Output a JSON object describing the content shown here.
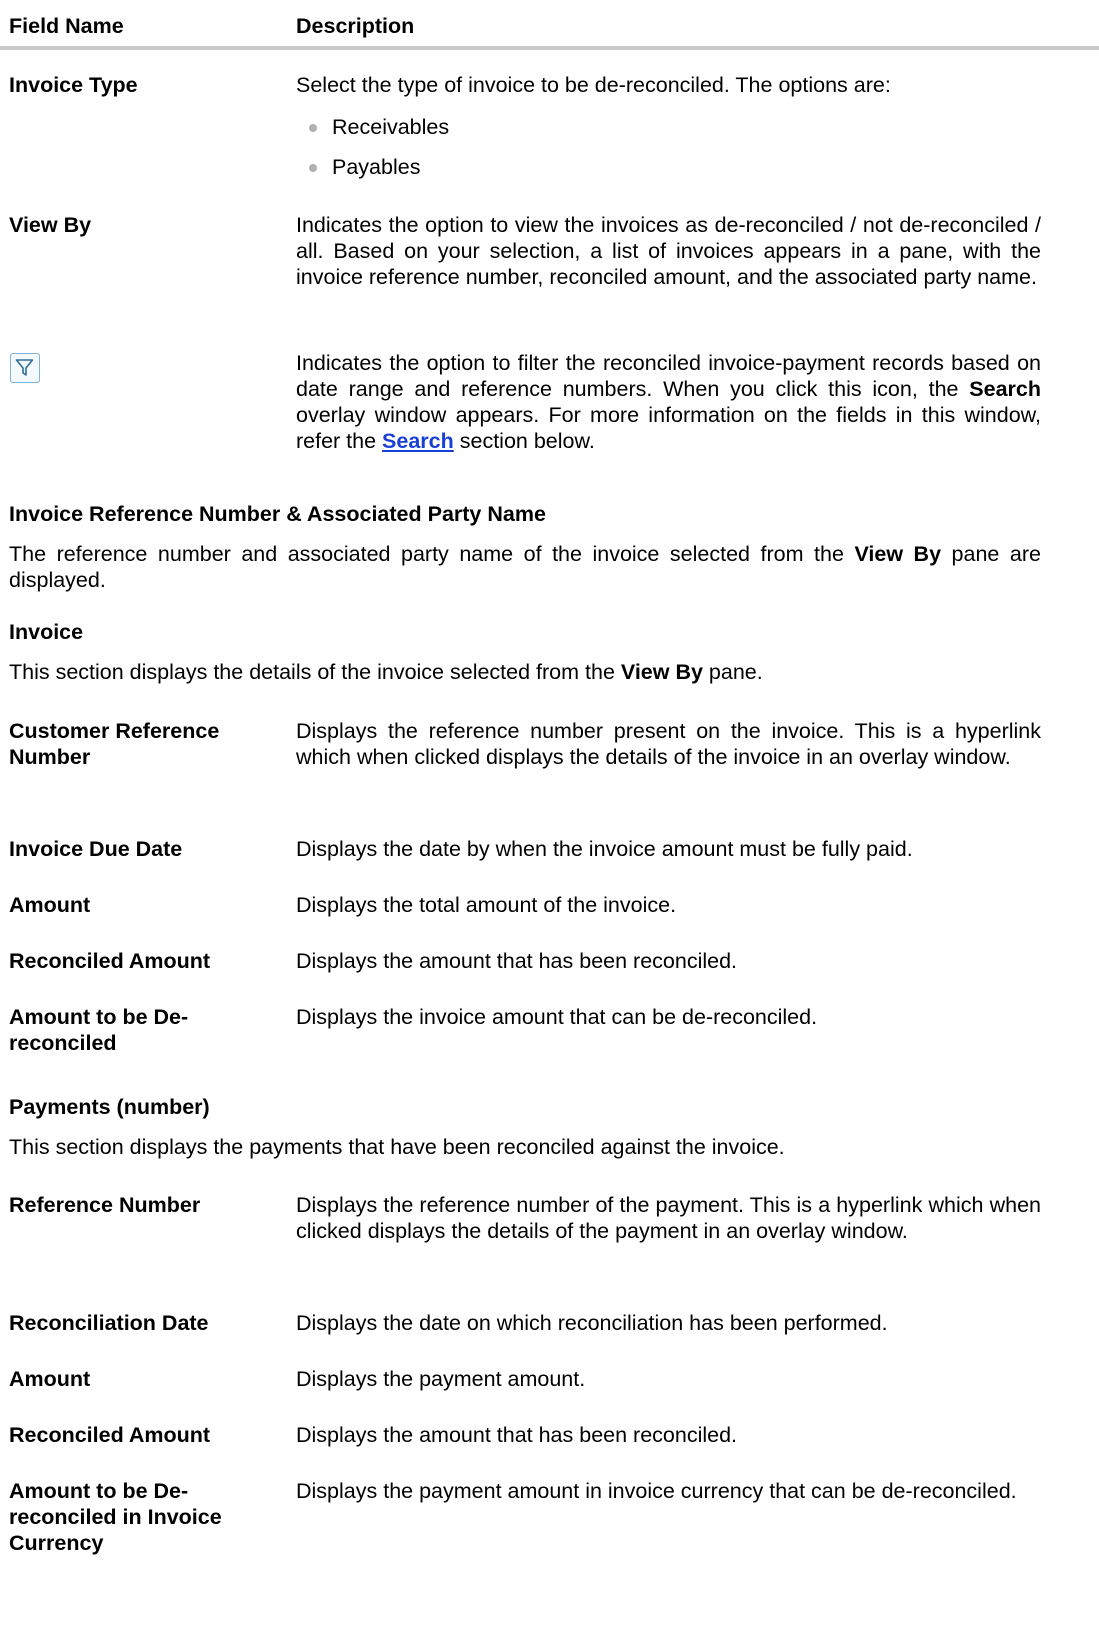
{
  "header": {
    "col1": "Field Name",
    "col2": "Description"
  },
  "invoice_type": {
    "label": "Invoice Type",
    "desc": "Select the type of invoice to be de-reconciled. The options are:",
    "options": [
      "Receivables",
      "Payables"
    ]
  },
  "view_by": {
    "label": "View By",
    "desc": "Indicates the option to view the invoices as de-reconciled / not de-reconciled / all. Based on your selection, a list of invoices appears in a pane, with the invoice reference number, reconciled amount, and the associated party name."
  },
  "filter": {
    "icon": "filter-icon",
    "desc_1": "Indicates the option to filter the reconciled invoice-payment records based on date range and reference numbers. When you click this icon, the ",
    "desc_bold": "Search",
    "desc_2": " overlay window appears. For more information on the fields in this window, refer the ",
    "link": "Search",
    "desc_3": " section below."
  },
  "section_ref": {
    "title": "Invoice Reference Number & Associated Party Name",
    "text_1": "The reference number and associated party name of the invoice selected from the ",
    "text_bold": "View By",
    "text_2": " pane are displayed."
  },
  "section_invoice": {
    "title": "Invoice",
    "text_1": "This section displays the details of the invoice selected from the ",
    "text_bold": "View By",
    "text_2": " pane.",
    "fields": [
      {
        "label": "Customer Reference Number",
        "desc": "Displays the reference number present on the invoice. This is a hyperlink which when clicked displays the details of the invoice in an overlay window."
      },
      {
        "label": "Invoice Due Date",
        "desc": "Displays the date by when the invoice amount must be fully paid."
      },
      {
        "label": "Amount",
        "desc": "Displays the total amount of the invoice."
      },
      {
        "label": "Reconciled Amount",
        "desc": "Displays the amount that has been reconciled."
      },
      {
        "label": "Amount to be De-reconciled",
        "desc": "Displays the invoice amount that can be de-reconciled."
      }
    ]
  },
  "section_payments": {
    "title": "Payments (number)",
    "text": "This section displays the payments that have been reconciled against the invoice.",
    "fields": [
      {
        "label": "Reference Number",
        "desc": "Displays the reference number of the payment. This is a hyperlink which when clicked displays the details of the payment in an overlay window."
      },
      {
        "label": "Reconciliation Date",
        "desc": "Displays the date on which reconciliation has been performed."
      },
      {
        "label": "Amount",
        "desc": "Displays the payment amount."
      },
      {
        "label": "Reconciled Amount",
        "desc": "Displays the amount that has been reconciled."
      },
      {
        "label": "Amount to be De-reconciled in Invoice Currency",
        "desc": "Displays the payment amount in invoice currency that can be de-reconciled."
      }
    ]
  }
}
